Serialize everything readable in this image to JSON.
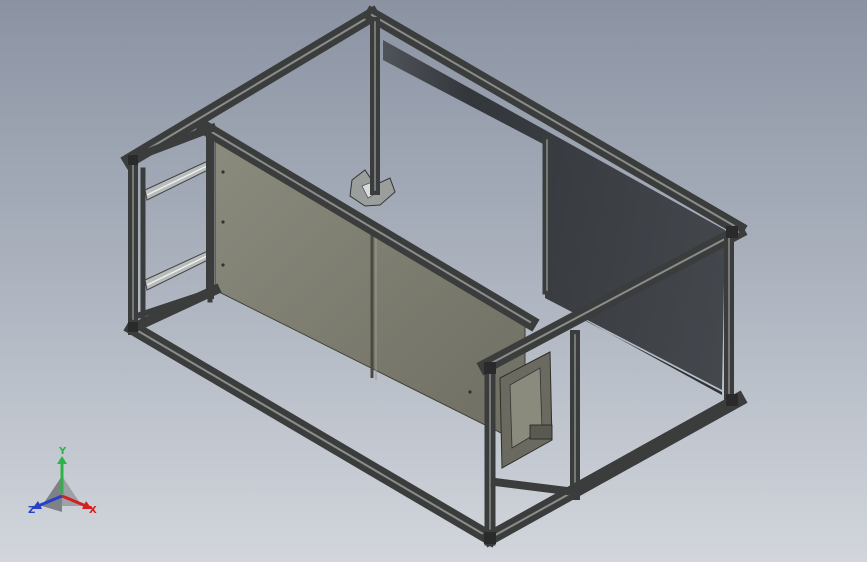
{
  "viewport": {
    "background_top": "#8b93a3",
    "background_bottom": "#d2d6dc"
  },
  "model": {
    "frame_color": "#3e4040",
    "frame_highlight": "#8a8d8c",
    "panel_color": "#7a7a6e",
    "glass_color": "#2c3034"
  },
  "triad": {
    "x_label": "X",
    "y_label": "Y",
    "z_label": "Z",
    "x_color": "#d32020",
    "y_color": "#2db34a",
    "z_color": "#2741c8"
  }
}
